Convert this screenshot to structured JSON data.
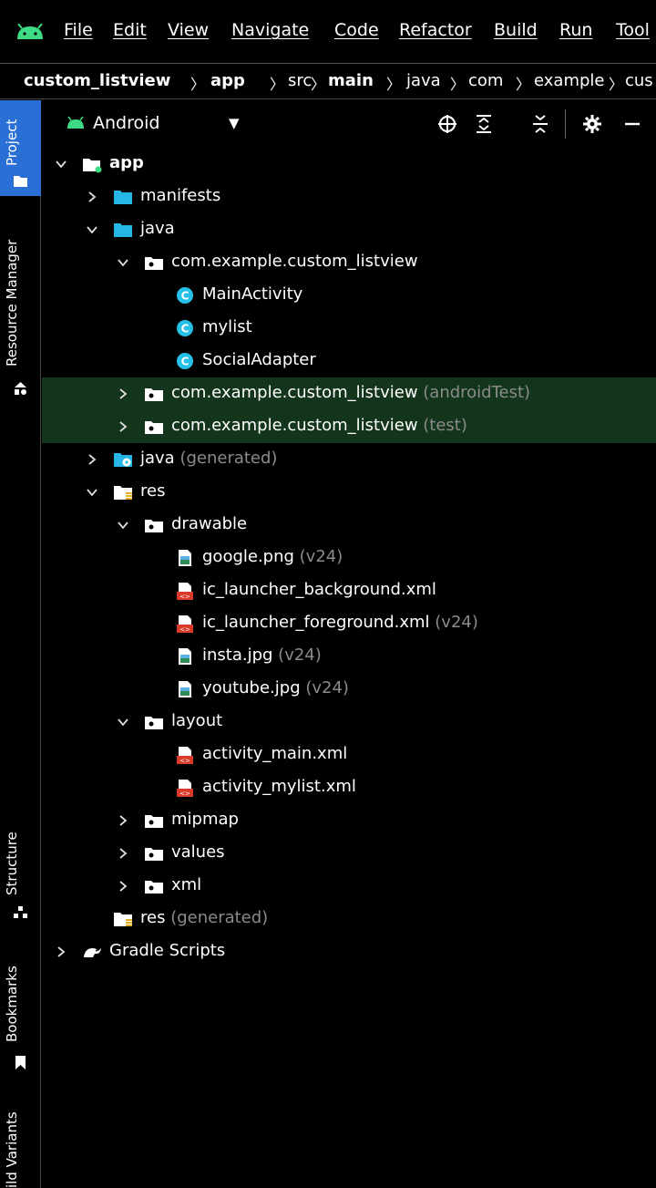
{
  "menubar": {
    "items": [
      "File",
      "Edit",
      "View",
      "Navigate",
      "Code",
      "Refactor",
      "Build",
      "Run",
      "Tool"
    ]
  },
  "breadcrumb": {
    "items": [
      {
        "label": "custom_listview",
        "bold": true
      },
      {
        "label": "app",
        "bold": true
      },
      {
        "label": "src",
        "bold": false
      },
      {
        "label": "main",
        "bold": true
      },
      {
        "label": "java",
        "bold": false
      },
      {
        "label": "com",
        "bold": false
      },
      {
        "label": "example",
        "bold": false
      },
      {
        "label": "cus",
        "bold": false
      }
    ]
  },
  "toolstrip": {
    "project": "Project",
    "resource_manager": "Resource Manager",
    "structure": "Structure",
    "bookmarks": "Bookmarks",
    "build_variants": "ild Variants"
  },
  "panel": {
    "title": "Android",
    "dropdown_icon": "caret-down-icon",
    "actions": [
      "locate-icon",
      "expand-all-icon",
      "collapse-all-icon",
      "gear-icon",
      "minimize-icon"
    ]
  },
  "tree": [
    {
      "label": "app",
      "suffix": "",
      "chevron": "open",
      "icon": "module",
      "bold": true,
      "sel": false
    },
    {
      "label": "manifests",
      "suffix": "",
      "chevron": "closed",
      "icon": "folder-blue",
      "bold": false,
      "sel": false
    },
    {
      "label": "java",
      "suffix": "",
      "chevron": "open",
      "icon": "folder-blue",
      "bold": false,
      "sel": false
    },
    {
      "label": "com.example.custom_listview",
      "suffix": "",
      "chevron": "open",
      "icon": "package",
      "bold": false,
      "sel": false
    },
    {
      "label": "MainActivity",
      "suffix": "",
      "chevron": "none",
      "icon": "class",
      "bold": false,
      "sel": false
    },
    {
      "label": "mylist",
      "suffix": "",
      "chevron": "none",
      "icon": "class",
      "bold": false,
      "sel": false
    },
    {
      "label": "SocialAdapter",
      "suffix": "",
      "chevron": "none",
      "icon": "class",
      "bold": false,
      "sel": false
    },
    {
      "label": "com.example.custom_listview",
      "suffix": " (androidTest)",
      "chevron": "closed",
      "icon": "package",
      "bold": false,
      "sel": true
    },
    {
      "label": "com.example.custom_listview",
      "suffix": " (test)",
      "chevron": "closed",
      "icon": "package",
      "bold": false,
      "sel": true
    },
    {
      "label": "java",
      "suffix": " (generated)",
      "chevron": "closed",
      "icon": "folder-generated",
      "bold": false,
      "sel": false
    },
    {
      "label": "res",
      "suffix": "",
      "chevron": "open",
      "icon": "folder-res",
      "bold": false,
      "sel": false
    },
    {
      "label": "drawable",
      "suffix": "",
      "chevron": "open",
      "icon": "package",
      "bold": false,
      "sel": false
    },
    {
      "label": "google.png",
      "suffix": " (v24)",
      "chevron": "none",
      "icon": "image-file",
      "bold": false,
      "sel": false
    },
    {
      "label": "ic_launcher_background.xml",
      "suffix": "",
      "chevron": "none",
      "icon": "xml-file",
      "bold": false,
      "sel": false
    },
    {
      "label": "ic_launcher_foreground.xml",
      "suffix": " (v24)",
      "chevron": "none",
      "icon": "xml-file",
      "bold": false,
      "sel": false
    },
    {
      "label": "insta.jpg",
      "suffix": " (v24)",
      "chevron": "none",
      "icon": "image-file",
      "bold": false,
      "sel": false
    },
    {
      "label": "youtube.jpg",
      "suffix": " (v24)",
      "chevron": "none",
      "icon": "image-file",
      "bold": false,
      "sel": false
    },
    {
      "label": "layout",
      "suffix": "",
      "chevron": "open",
      "icon": "package",
      "bold": false,
      "sel": false
    },
    {
      "label": "activity_main.xml",
      "suffix": "",
      "chevron": "none",
      "icon": "xml-file",
      "bold": false,
      "sel": false
    },
    {
      "label": "activity_mylist.xml",
      "suffix": "",
      "chevron": "none",
      "icon": "xml-file",
      "bold": false,
      "sel": false
    },
    {
      "label": "mipmap",
      "suffix": "",
      "chevron": "closed",
      "icon": "package",
      "bold": false,
      "sel": false
    },
    {
      "label": "values",
      "suffix": "",
      "chevron": "closed",
      "icon": "package",
      "bold": false,
      "sel": false
    },
    {
      "label": "xml",
      "suffix": "",
      "chevron": "closed",
      "icon": "package",
      "bold": false,
      "sel": false
    },
    {
      "label": "res",
      "suffix": " (generated)",
      "chevron": "none",
      "icon": "folder-res",
      "bold": false,
      "sel": false
    },
    {
      "label": "Gradle Scripts",
      "suffix": "",
      "chevron": "closed",
      "icon": "gradle",
      "bold": false,
      "sel": false
    }
  ],
  "colors": {
    "background": "#000000",
    "selected_row": "#12351c",
    "project_tab": "#2a6fd6",
    "class_icon": "#27c0e6",
    "folder_blue": "#27b6e6",
    "muted_text": "#8b8b8b",
    "android_green": "#3ddc84"
  }
}
